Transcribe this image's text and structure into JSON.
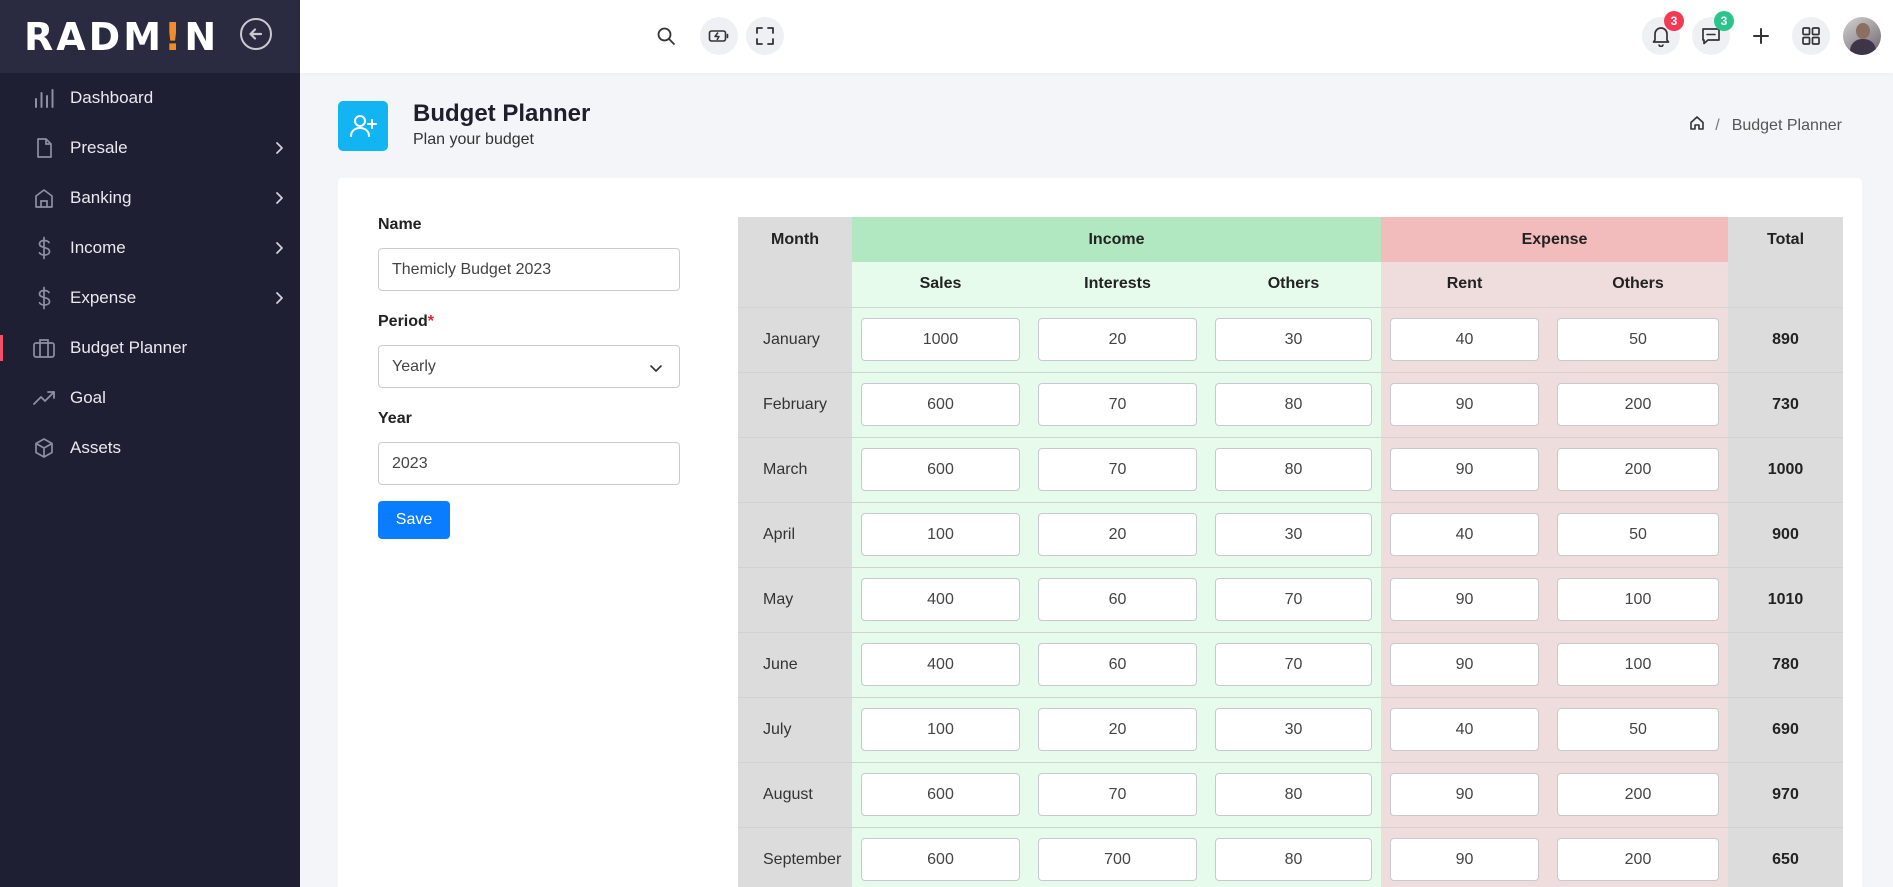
{
  "brand": {
    "logo_main": "RADM",
    "logo_accent": "!",
    "logo_end": "N"
  },
  "sidebar": {
    "items": [
      {
        "label": "Dashboard",
        "icon": "bar-chart-icon",
        "has_submenu": false
      },
      {
        "label": "Presale",
        "icon": "file-icon",
        "has_submenu": true
      },
      {
        "label": "Banking",
        "icon": "bank-icon",
        "has_submenu": true
      },
      {
        "label": "Income",
        "icon": "dollar-icon",
        "has_submenu": true
      },
      {
        "label": "Expense",
        "icon": "dollar-icon",
        "has_submenu": true
      },
      {
        "label": "Budget Planner",
        "icon": "briefcase-icon",
        "has_submenu": false,
        "active": true
      },
      {
        "label": "Goal",
        "icon": "trending-up-icon",
        "has_submenu": false
      },
      {
        "label": "Assets",
        "icon": "box-icon",
        "has_submenu": false
      }
    ]
  },
  "topbar": {
    "notifications_count": "3",
    "messages_count": "3",
    "notification_badge_color": "#f23a55",
    "message_badge_color": "#2bc48a"
  },
  "page": {
    "title": "Budget Planner",
    "subtitle": "Plan your budget",
    "breadcrumb_current": "Budget Planner",
    "breadcrumb_separator": "/"
  },
  "form": {
    "name_label": "Name",
    "name_value": "Themicly Budget 2023",
    "period_label": "Period",
    "period_required": "*",
    "period_value": "Yearly",
    "year_label": "Year",
    "year_value": "2023",
    "save_label": "Save"
  },
  "table": {
    "headers": {
      "month": "Month",
      "income": "Income",
      "expense": "Expense",
      "total": "Total",
      "sales": "Sales",
      "interests": "Interests",
      "income_others": "Others",
      "rent": "Rent",
      "expense_others": "Others"
    },
    "rows": [
      {
        "month": "January",
        "sales": "1000",
        "interests": "20",
        "others": "30",
        "rent": "40",
        "expense_others": "50",
        "total": "890"
      },
      {
        "month": "February",
        "sales": "600",
        "interests": "70",
        "others": "80",
        "rent": "90",
        "expense_others": "200",
        "total": "730"
      },
      {
        "month": "March",
        "sales": "600",
        "interests": "70",
        "others": "80",
        "rent": "90",
        "expense_others": "200",
        "total": "1000"
      },
      {
        "month": "April",
        "sales": "100",
        "interests": "20",
        "others": "30",
        "rent": "40",
        "expense_others": "50",
        "total": "900"
      },
      {
        "month": "May",
        "sales": "400",
        "interests": "60",
        "others": "70",
        "rent": "90",
        "expense_others": "100",
        "total": "1010"
      },
      {
        "month": "June",
        "sales": "400",
        "interests": "60",
        "others": "70",
        "rent": "90",
        "expense_others": "100",
        "total": "780"
      },
      {
        "month": "July",
        "sales": "100",
        "interests": "20",
        "others": "30",
        "rent": "40",
        "expense_others": "50",
        "total": "690"
      },
      {
        "month": "August",
        "sales": "600",
        "interests": "70",
        "others": "80",
        "rent": "90",
        "expense_others": "200",
        "total": "970"
      },
      {
        "month": "September",
        "sales": "600",
        "interests": "700",
        "others": "80",
        "rent": "90",
        "expense_others": "200",
        "total": "650"
      }
    ]
  }
}
